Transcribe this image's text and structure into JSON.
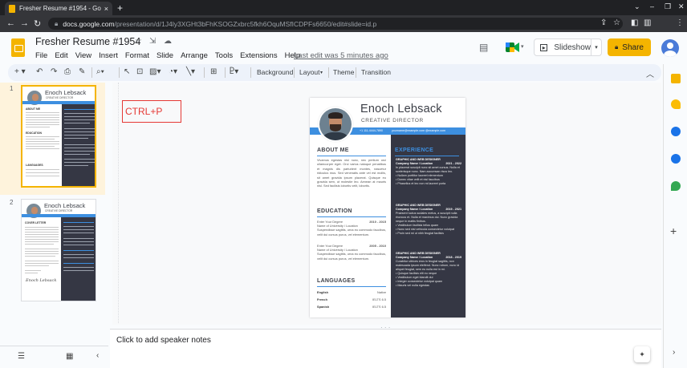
{
  "browser": {
    "tab_title": "Fresher Resume #1954 - Google",
    "url_host": "docs.google.com",
    "url_path": "/presentation/d/1J4ly3XGHt3bFhKSOGZxbrc5fkh6OquMSfICDPFs6650/edit#slide=id.p"
  },
  "app": {
    "doc_title": "Fresher Resume #1954",
    "menu": [
      "File",
      "Edit",
      "View",
      "Insert",
      "Format",
      "Slide",
      "Arrange",
      "Tools",
      "Extensions",
      "Help"
    ],
    "last_edit": "Last edit was 5 minutes ago",
    "slideshow_label": "Slideshow",
    "share_label": "Share"
  },
  "toolbar": {
    "background": "Background",
    "layout": "Layout",
    "theme": "Theme",
    "transition": "Transition"
  },
  "filmstrip": {
    "slides": [
      "1",
      "2"
    ]
  },
  "annotation": {
    "text": "CTRL+P"
  },
  "notes": {
    "placeholder": "Click to add speaker notes"
  },
  "resume": {
    "name": "Enoch Lebsack",
    "role": "CREATIVE DIRECTOR",
    "phone": "+1 111-4444-7890",
    "email1": "yourname@example.com",
    "email2": "@example.com",
    "about_heading": "ABOUT ME",
    "about_text": "Vivamus egestas nisl nunc, nec pretium orci ullamcorper eget. Orci varius natoque penatibus et magnis dis parturient montes, nascetur ridiculus mus. Sed venenatis ante vel est mollis, sit amet gravida ipsum placerat. Quisque eu gravida sem, ut molestie leo. Aenean at mauris nisl. Sed facilisis lobortis velit, lobortis.",
    "education_heading": "EDUCATION",
    "education": [
      {
        "degree": "Enter Your Degree",
        "years": "2010 - 2015",
        "school": "Name of University / Location",
        "desc": "Suspendisse sagittis, urna eu commodo faucibus, velit dui cursus purus, vel elementum."
      },
      {
        "degree": "Enter Your Degree",
        "years": "2005 - 2010",
        "school": "Name of University / Location",
        "desc": "Suspendisse sagittis, urna eu commodo faucibus, velit dui cursus purus, vel elementum."
      }
    ],
    "languages_heading": "LANGUAGES",
    "languages": [
      {
        "lang": "English",
        "level": "Native"
      },
      {
        "lang": "French",
        "level": "IELTS 6.5"
      },
      {
        "lang": "Spanish",
        "level": "IELTS 6.5"
      }
    ],
    "experience_heading": "EXPERIENCE",
    "jobs": [
      {
        "title": "GRAPHIC AND WEB DESIGNER",
        "company": "Company Name / Location",
        "years": "2021 - 2022",
        "desc": "In placerat suscipit nunc sit amet cursus. Nulla et scelerisque nunc. Nam accumsan risus leo.",
        "bullets": [
          "Nullam porttitor laoreet elementum",
          "Donec vitae velit et nisl faucibus",
          "Phasellus et leo non mi laoreet porta"
        ]
      },
      {
        "title": "GRAPHIC AND WEB DESIGNER",
        "company": "Company Name / Location",
        "years": "2019 - 2021",
        "desc": "Praesent luctus sodales metus, a suscipit nulla rhoncus et. Nulla et maximus dui. Nunc gravida neque in mattis finibus.",
        "bullets": [
          "Vestibulum facilisis tellus quam",
          "Nunc sed nisi vehicula consectetur volutpat",
          "Proin sed mi ut nibh feugiat facilisis"
        ]
      },
      {
        "title": "GRAPHIC AND WEB DESIGNER",
        "company": "Company Name / Location",
        "years": "2018 - 2019",
        "desc": "Curabitur ultrices eros in feugiat sagittis, non malesuada ipsum eleifend. Nunc rutrum, nunc id aliquet feugiat, sem eu nulla est in mi.",
        "bullets": [
          "Quisque facilisis elit eu neque",
          "Vestibulum eget blandit dui",
          "Integer consectetur volutpat quam",
          "Mauris vel nulla egestas"
        ]
      }
    ]
  },
  "thumb2": {
    "cover_letter": "COVER LETTER",
    "signature": "Enoch Lebsack"
  },
  "colors": {
    "accent": "#3d8fe0",
    "dark_panel": "#353744",
    "slides_yellow": "#f4b400",
    "annotation_red": "#e53935"
  },
  "icons": [
    "star-icon",
    "move-icon",
    "cloud-icon",
    "comment-icon",
    "meet-icon",
    "present-icon",
    "lock-icon"
  ]
}
